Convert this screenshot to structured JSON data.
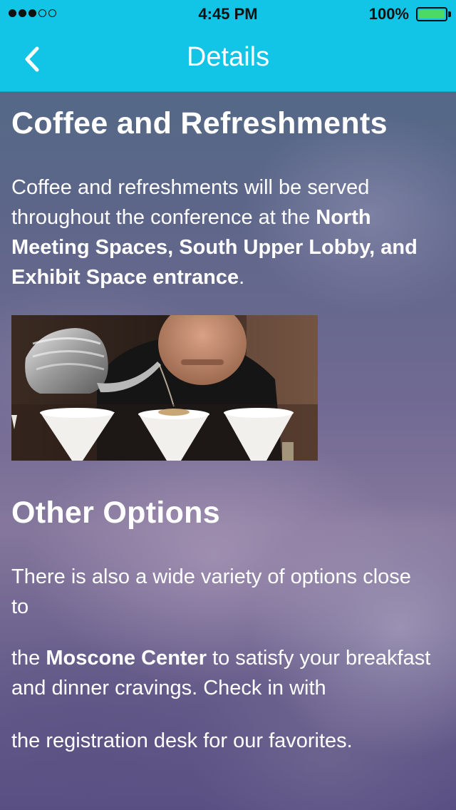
{
  "status_bar": {
    "signal_dots_filled": 3,
    "signal_dots_total": 5,
    "time": "4:45 PM",
    "battery_percent": "100%",
    "battery_level": 1.0
  },
  "nav": {
    "back_icon": "chevron-left-icon",
    "title": "Details"
  },
  "sections": {
    "coffee": {
      "heading": "Coffee and Refreshments",
      "text_1": "Coffee and refreshments will be served throughout the conference at the ",
      "bold_1": "North Meeting Spaces, South Upper Lobby, and Exhibit Space entrance",
      "text_2": "."
    },
    "other": {
      "heading": "Other Options",
      "para_1": "There is also a wide variety of options close to",
      "para_2_prefix": "the ",
      "para_2_bold": "Moscone Center",
      "para_2_suffix": " to satisfy your breakfast and dinner cravings. Check in with",
      "para_3": "the registration desk for our favorites."
    }
  },
  "colors": {
    "nav_background": "#12c4e6",
    "battery_fill": "#4cd964",
    "text": "#ffffff"
  }
}
